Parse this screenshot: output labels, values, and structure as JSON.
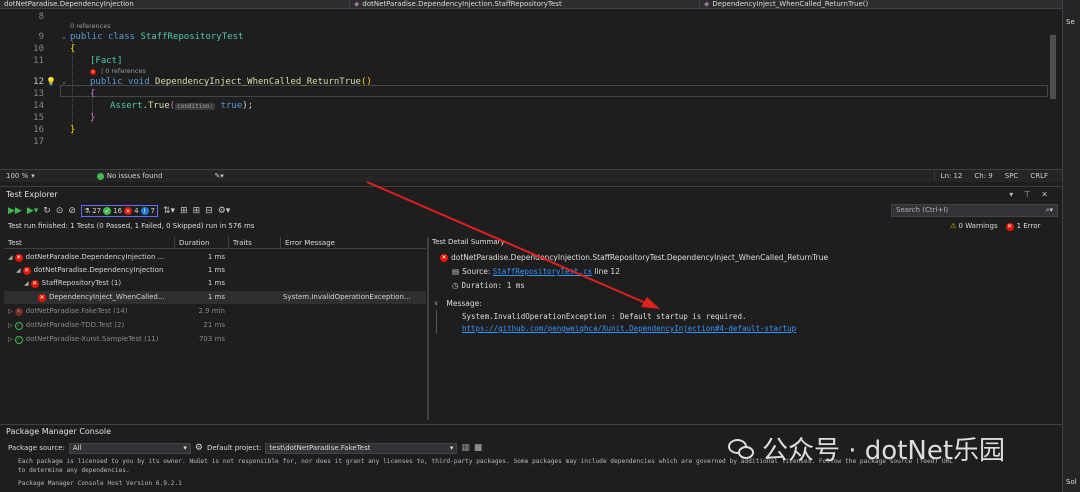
{
  "navbar": {
    "project": "dotNetParadise.DependencyInjection",
    "class_path": "dotNetParadise.DependencyInjection.StaffRepositoryTest",
    "method": "DependencyInject_WhenCalled_ReturnTrue()"
  },
  "editor": {
    "line_8": "8",
    "line_9": "9",
    "line_10": "10",
    "line_11": "11",
    "line_12": "12",
    "line_13": "13",
    "line_14": "14",
    "line_15": "15",
    "line_16": "16",
    "line_17": "17",
    "refs_class": "0 references",
    "refs_method": "0 references",
    "kw_public": "public",
    "kw_class": "class",
    "class_name": "StaffRepositoryTest",
    "open_brace": "{",
    "close_brace": "}",
    "attribute": "[Fact]",
    "kw_public2": "public",
    "kw_void": "void",
    "method_name": "DependencyInject_WhenCalled_ReturnTrue",
    "parens": "()",
    "assert_class": "Assert",
    "assert_method": "True",
    "param_hint": "condition:",
    "kw_true": "true",
    "stmt_end": ");"
  },
  "statusline": {
    "zoom": "100 %",
    "issues": "No issues found",
    "ln": "Ln: 12",
    "ch": "Ch: 9",
    "spc": "SPC",
    "crlf": "CRLF"
  },
  "test_explorer": {
    "title": "Test Explorer",
    "count_total": "27",
    "count_passed": "16",
    "count_failed": "4",
    "count_skipped": "7",
    "search_placeholder": "Search (Ctrl+I)",
    "run_summary": "Test run finished: 1 Tests (0 Passed, 1 Failed, 0 Skipped) run in 576 ms",
    "warnings": "0 Warnings",
    "errors": "1 Error",
    "columns": [
      "Test",
      "Duration",
      "Traits",
      "Error Message"
    ],
    "rows": [
      {
        "name": "dotNetParadise.DependencyInjection ...",
        "duration": "1 ms",
        "error": "",
        "status": "fail"
      },
      {
        "name": "dotNetParadise.DependencyInjection",
        "duration": "1 ms",
        "error": "",
        "status": "fail"
      },
      {
        "name": "StaffRepositoryTest (1)",
        "duration": "1 ms",
        "error": "",
        "status": "fail"
      },
      {
        "name": "DependencyInject_WhenCalled...",
        "duration": "1 ms",
        "error": "System.InvalidOperationException...",
        "status": "fail"
      },
      {
        "name": "dotNetParadise.FakeTest (14)",
        "duration": "2.9 min",
        "error": "",
        "status": "fail-dim"
      },
      {
        "name": "dotNetParadise-TDD.Test (2)",
        "duration": "21 ms",
        "error": "",
        "status": "pass"
      },
      {
        "name": "dotNetParadise-Xunit.SampleTest (11)",
        "duration": "703 ms",
        "error": "",
        "status": "pass"
      }
    ],
    "detail": {
      "title": "Test Detail Summary",
      "test_name": "dotNetParadise.DependencyInjection.StaffRepositoryTest.DependencyInject_WhenCalled_ReturnTrue",
      "source_label": "Source:",
      "source_file": "StaffRepositoryTest.cs",
      "source_line": "line 12",
      "duration": "Duration: 1 ms",
      "message_label": "Message:",
      "message": "System.InvalidOperationException : Default startup is required.",
      "message_link": "https://github.com/pengweiqhca/Xunit.DependencyInjection#4-default-startup"
    }
  },
  "pmc": {
    "title": "Package Manager Console",
    "source_label": "Package source:",
    "source_value": "All",
    "project_label": "Default project:",
    "project_value": "test\\dotNetParadise.FakeTest",
    "text_line1": "Each package is licensed to you by its owner. NuGet is not responsible for, nor does it grant any licenses to, third-party packages. Some packages may include dependencies which are governed by additional licenses. Follow the package source (feed) URL",
    "text_line2": "to determine any dependencies.",
    "text_line3": "Package Manager Console Host Version 6.9.2.1"
  },
  "watermark": {
    "text": "公众号 · dotNet乐园"
  },
  "right_strip": {
    "top": "Se",
    "bottom": "Sol"
  },
  "colors": {
    "accent_blue": "#3794ff",
    "fail_red": "#e51400",
    "pass_green": "#3fb950",
    "annotation_arrow": "#e0201c"
  }
}
